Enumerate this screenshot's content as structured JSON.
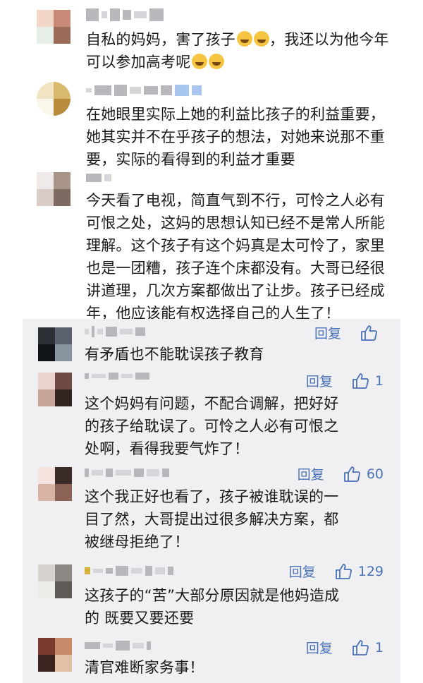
{
  "comments": [
    {
      "text_lines": [
        "自私的妈妈，害了孩子",
        "，我还以为他今年",
        "可以参加高考呢"
      ],
      "avatar_colors": [
        "#f2d7c8",
        "#c88a76",
        "#e5efe8",
        "#9b6b5a"
      ]
    },
    {
      "text_lines": [
        "在她眼里实际上她的利益比孩子的利益重要，",
        "她其实并不在乎孩子的想法，对她来说那不重",
        "要，实际的看得到的利益才重要"
      ],
      "avatar_colors": [
        "#f1e4c3",
        "#d9b96d",
        "#fbf6ea",
        "#b98c3c"
      ]
    },
    {
      "text_lines": [
        "今天看了电视，简直气到不行，可怜之人必有",
        "可恨之处，这妈的思想认知已经不是常人所能",
        "理解。这个孩子有这个妈真是太可怜了，家里",
        "也是一团糟，孩子连个床都没有。大哥已经很",
        "讲道理，几次方案都做出了让步。孩子已经成",
        "年，他应该能有权选择自己的人生了！"
      ],
      "avatar_colors": [
        "#efeae7",
        "#a99489",
        "#d8ccc5",
        "#7d6b62"
      ]
    }
  ],
  "replies": [
    {
      "text_lines": [
        "有矛盾也不能耽误孩子教育"
      ],
      "reply_label": "回复",
      "likes": "",
      "avatar_colors": [
        "#2b2f36",
        "#5a6270",
        "#111418",
        "#8a93a0"
      ]
    },
    {
      "text_lines": [
        "这个妈妈有问题，不配合调解，把好好",
        "的孩子给耽误了。可怜之人必有可恨之",
        "处啊，看得我要气炸了！"
      ],
      "reply_label": "回复",
      "likes": "1",
      "avatar_colors": [
        "#e9d3cc",
        "#6d4a44",
        "#c7a59b",
        "#33251f"
      ]
    },
    {
      "text_lines": [
        "这个我正好也看了，孩子被谁耽误的一",
        "目了然，大哥提出过很多解决方案，都",
        "被继母拒绝了！"
      ],
      "reply_label": "回复",
      "likes": "60",
      "avatar_colors": [
        "#f4e3dc",
        "#3a2a28",
        "#d9b3a4",
        "#8c6257"
      ]
    },
    {
      "text_lines": [
        "这孩子的“苦”大部分原因就是他妈造成",
        "的 既要又要还要"
      ],
      "reply_label": "回复",
      "likes": "129",
      "avatar_colors": [
        "#d7d4d0",
        "#8d8883",
        "#eeece9",
        "#5e5a56"
      ]
    },
    {
      "text_lines": [
        "清官难断家务事！"
      ],
      "reply_label": "回复",
      "likes": "1",
      "avatar_colors": [
        "#7a3b2e",
        "#c98a6a",
        "#3b2320",
        "#e2c0a4"
      ]
    }
  ]
}
